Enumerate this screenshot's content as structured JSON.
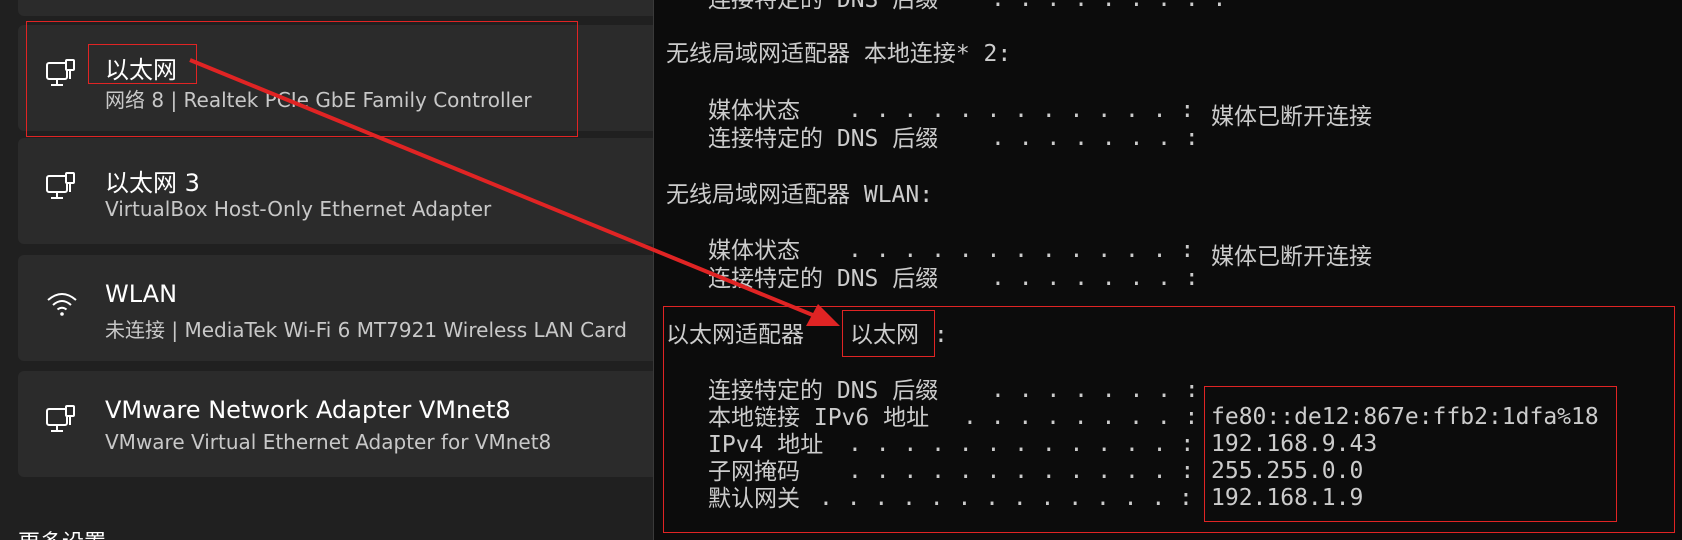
{
  "settings": {
    "adapters": [
      {
        "name": "以太网",
        "desc": "网络 8 | Realtek PCIe GbE Family Controller",
        "icon": "ethernet-icon"
      },
      {
        "name": "以太网 3",
        "desc": "VirtualBox Host-Only Ethernet Adapter",
        "icon": "ethernet-icon"
      },
      {
        "name": "WLAN",
        "desc": "未连接 | MediaTek Wi-Fi 6 MT7921 Wireless LAN Card",
        "icon": "wifi-icon"
      },
      {
        "name": "VMware Network Adapter VMnet8",
        "desc": "VMware Virtual Ethernet Adapter for VMnet8",
        "icon": "ethernet-icon"
      }
    ],
    "bottom_partial_text": "更多设置"
  },
  "terminal": {
    "top_partial": {
      "label": "连接特定的 DNS 后缀",
      "dots": ". . . . . . . . :"
    },
    "sections": [
      {
        "header": "无线局域网适配器 本地连接* 2:",
        "rows": [
          {
            "label": "媒体状态",
            "dots": ". . . . . . . . . . . . :",
            "value": "媒体已断开连接"
          },
          {
            "label": "连接特定的 DNS 后缀",
            "dots": ". . . . . . . :",
            "value": ""
          }
        ]
      },
      {
        "header": "无线局域网适配器 WLAN:",
        "rows": [
          {
            "label": "媒体状态",
            "dots": ". . . . . . . . . . . . :",
            "value": "媒体已断开连接"
          },
          {
            "label": "连接特定的 DNS 后缀",
            "dots": ". . . . . . . :",
            "value": ""
          }
        ]
      },
      {
        "header_prefix": "以太网适配器",
        "header_name": "以太网",
        "header_suffix": ":",
        "rows": [
          {
            "label": "连接特定的 DNS 后缀",
            "dots": ". . . . . . . :",
            "value": ""
          },
          {
            "label": "本地链接 IPv6 地址",
            "dots": ". . . . . . . . :",
            "value": "fe80::de12:867e:ffb2:1dfa%18"
          },
          {
            "label": "IPv4 地址",
            "dots": ". . . . . . . . . . . . :",
            "value": "192.168.9.43"
          },
          {
            "label": "子网掩码",
            "dots": ". . . . . . . . . . . . :",
            "value": "255.255.0.0"
          },
          {
            "label": "默认网关",
            "dots": ". . . . . . . . . . . . . :",
            "value": "192.168.1.9"
          }
        ]
      }
    ]
  },
  "colors": {
    "annotation": "#e02424",
    "terminal_bg": "#0c0c0c",
    "terminal_fg": "#cccccc",
    "card_bg": "#2b2b2b"
  }
}
